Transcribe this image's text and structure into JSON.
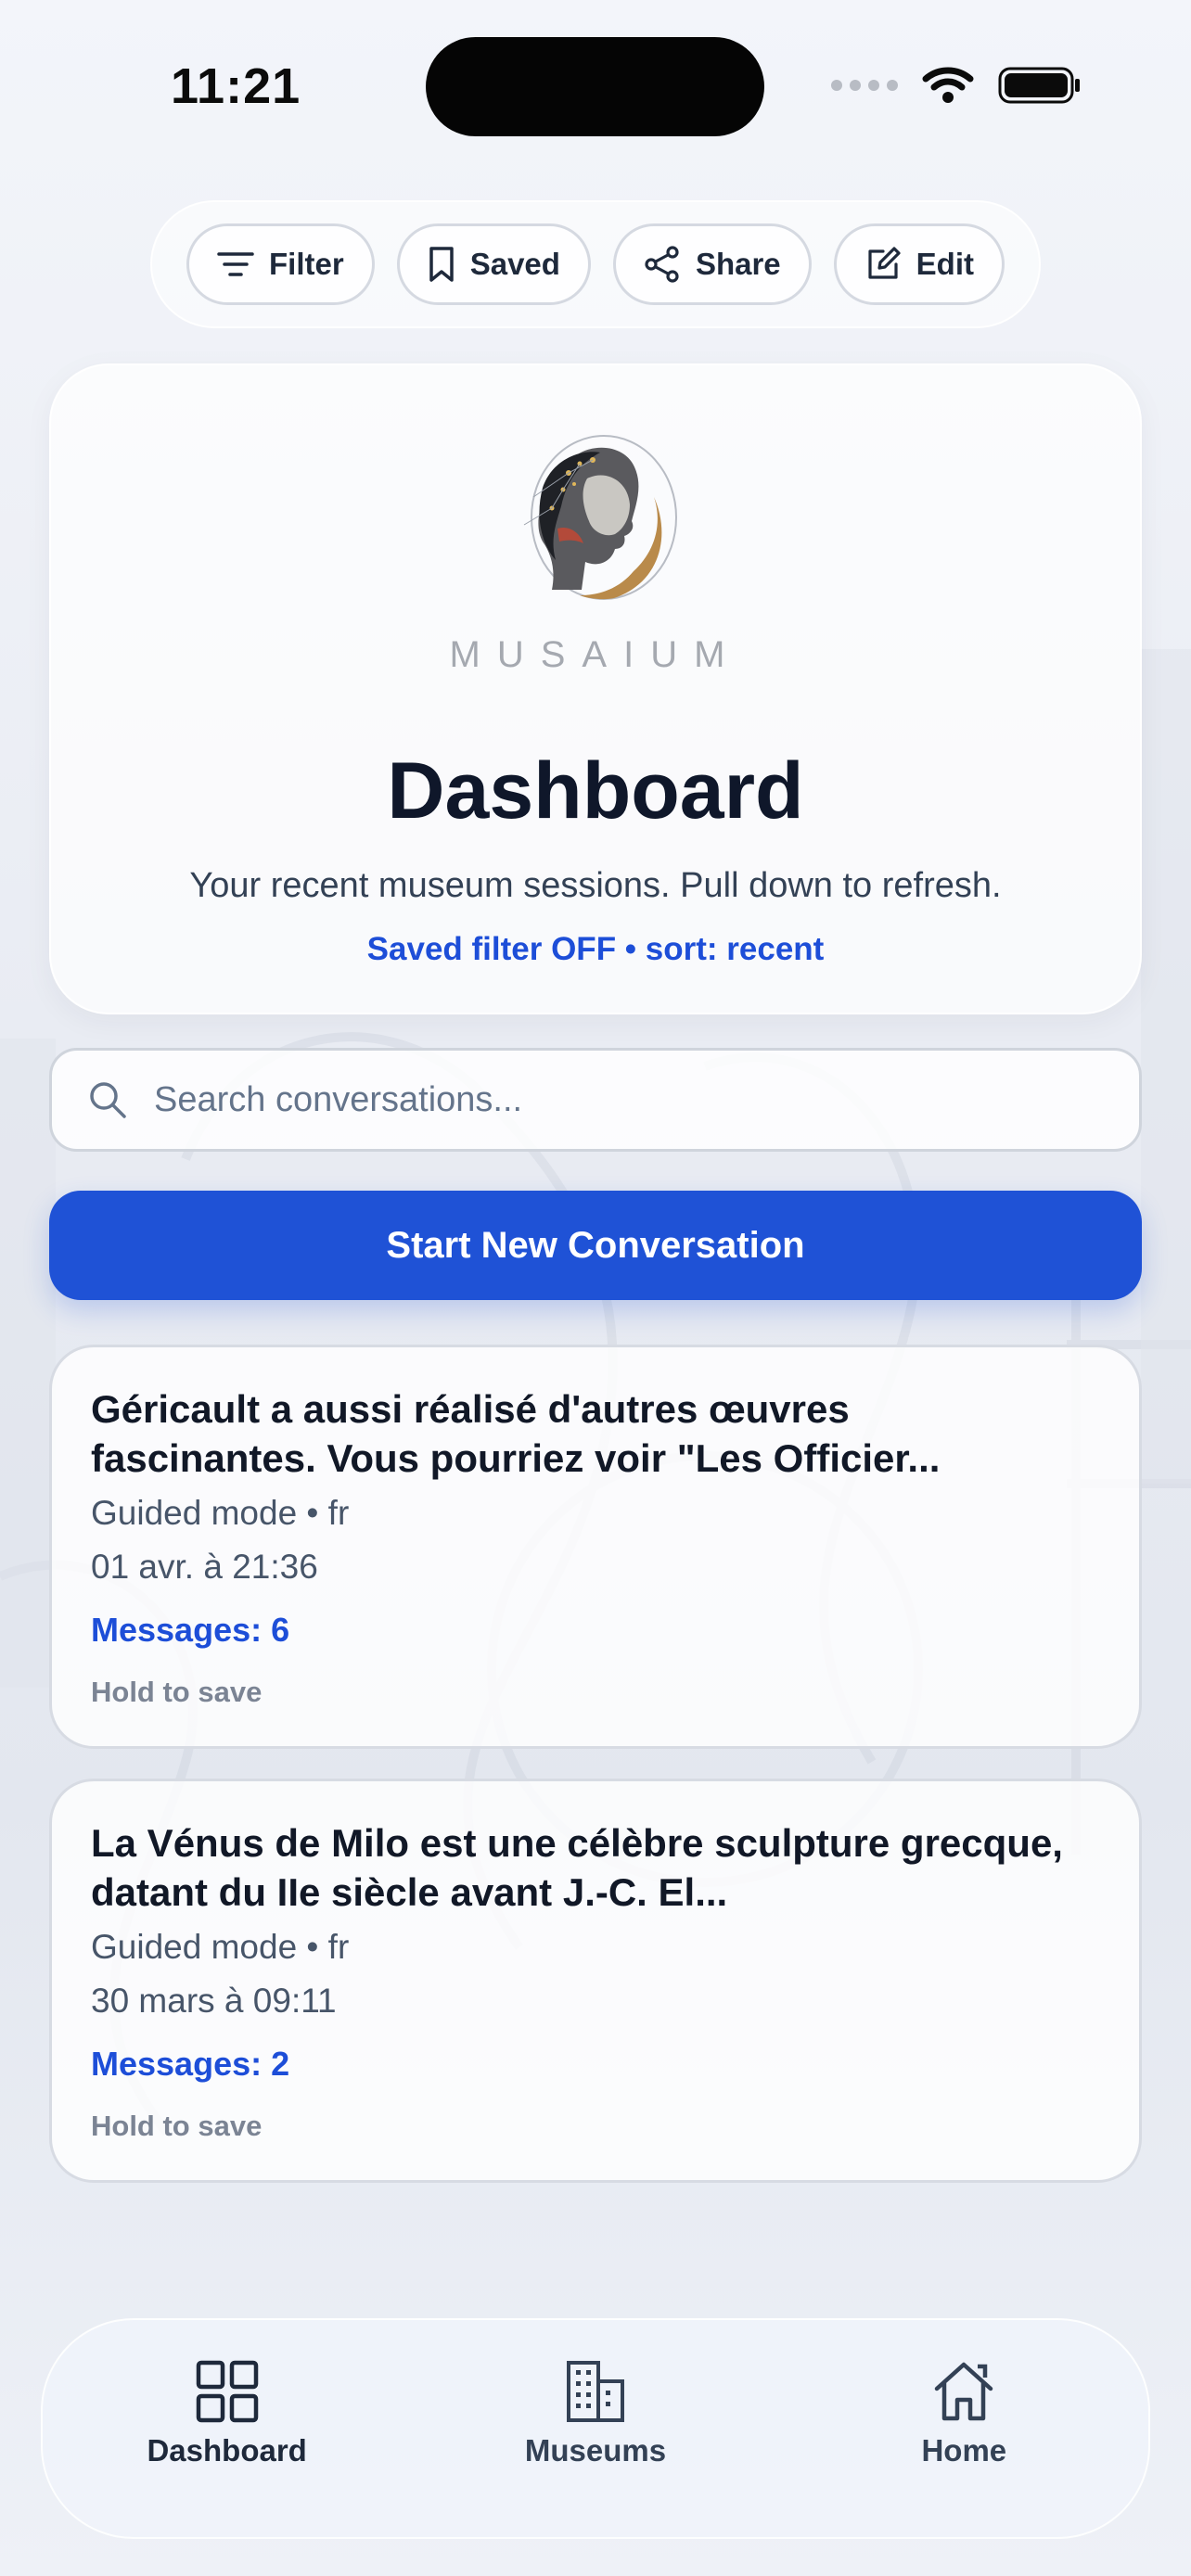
{
  "status_bar": {
    "time": "11:21"
  },
  "toolbar": {
    "filter_label": "Filter",
    "saved_label": "Saved",
    "share_label": "Share",
    "edit_label": "Edit"
  },
  "hero": {
    "brand": "MUSAIUM",
    "title": "Dashboard",
    "subtitle": "Your recent museum sessions. Pull down to refresh.",
    "filter_status": "Saved filter OFF • sort: recent"
  },
  "search": {
    "placeholder": "Search conversations...",
    "value": ""
  },
  "primary_action": {
    "label": "Start New Conversation"
  },
  "conversations": [
    {
      "title": "Géricault a aussi réalisé d'autres œuvres fascinantes. Vous pourriez voir \"Les Officier...",
      "mode": "Guided mode • fr",
      "date": "01 avr. à 21:36",
      "messages": "Messages: 6",
      "hint": "Hold to save"
    },
    {
      "title": "La Vénus de Milo est une célèbre sculpture grecque, datant du IIe siècle avant J.-C. El...",
      "mode": "Guided mode • fr",
      "date": "30 mars à 09:11",
      "messages": "Messages: 2",
      "hint": "Hold to save"
    }
  ],
  "tabbar": {
    "items": [
      {
        "label": "Dashboard",
        "icon": "grid-icon"
      },
      {
        "label": "Museums",
        "icon": "building-icon"
      },
      {
        "label": "Home",
        "icon": "home-icon"
      }
    ]
  },
  "colors": {
    "accent": "#1f52d6",
    "link": "#1d4ed8",
    "text": "#0f172a"
  }
}
